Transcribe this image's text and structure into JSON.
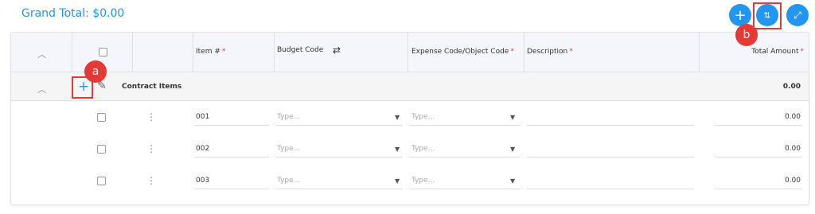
{
  "grand_total": "Grand Total: $0.00",
  "toolbar": {
    "add_icon": "plus-icon",
    "sort_icon": "sort-arrows-icon",
    "expand_icon": "expand-icon"
  },
  "callouts": {
    "a": "a",
    "b": "b"
  },
  "columns": {
    "item_num": "Item #",
    "budget_code": "Budget Code",
    "expense_code": "Expense Code/Object Code",
    "description": "Description",
    "total_amount": "Total Amount",
    "required_mark": "*"
  },
  "group": {
    "title": "Contract Items",
    "total": "0.00"
  },
  "rows": [
    {
      "item": "001",
      "budget_placeholder": "Type...",
      "expense_placeholder": "Type...",
      "amount": "0.00"
    },
    {
      "item": "002",
      "budget_placeholder": "Type...",
      "expense_placeholder": "Type...",
      "amount": "0.00"
    },
    {
      "item": "003",
      "budget_placeholder": "Type...",
      "expense_placeholder": "Type...",
      "amount": "0.00"
    }
  ],
  "colors": {
    "accent": "#2196F3",
    "callout": "#e53935"
  }
}
